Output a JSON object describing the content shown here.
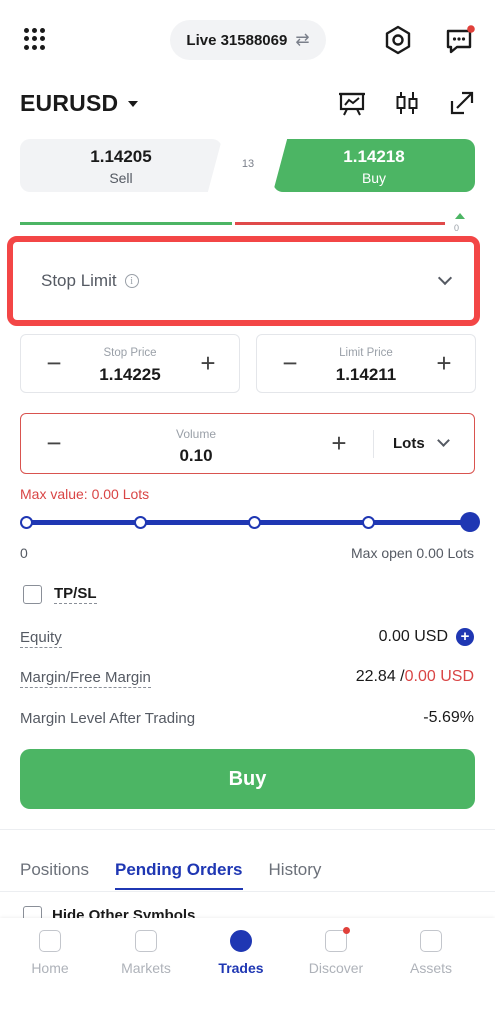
{
  "header": {
    "account_label": "Live 31588069",
    "icons": [
      "apps-grid-icon",
      "swap-icon",
      "settings-hexagon-icon",
      "messages-icon"
    ]
  },
  "symbol": {
    "name": "EURUSD",
    "tools": [
      "chart-presentation-icon",
      "candlestick-icon",
      "expand-icon"
    ]
  },
  "quote": {
    "sell_price": "1.14205",
    "sell_label": "Sell",
    "spread": "13",
    "buy_price": "1.14218",
    "buy_label": "Buy",
    "indicator_value": "0"
  },
  "order_type": {
    "value": "Stop Limit",
    "info_glyph": "i"
  },
  "stop_price": {
    "caption": "Stop Price",
    "value": "1.14225"
  },
  "limit_price": {
    "caption": "Limit Price",
    "value": "1.14211"
  },
  "volume": {
    "caption": "Volume",
    "value": "0.10",
    "unit": "Lots",
    "max_value_text": "Max value: 0.00 Lots"
  },
  "slider": {
    "min_label": "0",
    "max_label": "Max open 0.00 Lots",
    "position": 1.0
  },
  "tpsl": {
    "label": "TP/SL",
    "checked": false
  },
  "account_info": {
    "equity_label": "Equity",
    "equity_value": "0.00 USD",
    "margin_label": "Margin/Free Margin",
    "margin_value": "22.84 /",
    "free_margin_value": "0.00 USD",
    "margin_level_label": "Margin Level After Trading",
    "margin_level_value": "-5.69%"
  },
  "buy_button_label": "Buy",
  "tabs": [
    "Positions",
    "Pending Orders",
    "History"
  ],
  "active_tab": "Pending Orders",
  "hide_other_label": "Hide Other Symbols",
  "nav": [
    {
      "label": "Home",
      "icon": "home-chart-icon"
    },
    {
      "label": "Markets",
      "icon": "markets-bar-icon"
    },
    {
      "label": "Trades",
      "icon": "trades-icon"
    },
    {
      "label": "Discover",
      "icon": "discover-icon"
    },
    {
      "label": "Assets",
      "icon": "assets-icon"
    }
  ],
  "colors": {
    "green": "#4cb564",
    "red": "#f34646",
    "blue": "#1f37b3"
  }
}
